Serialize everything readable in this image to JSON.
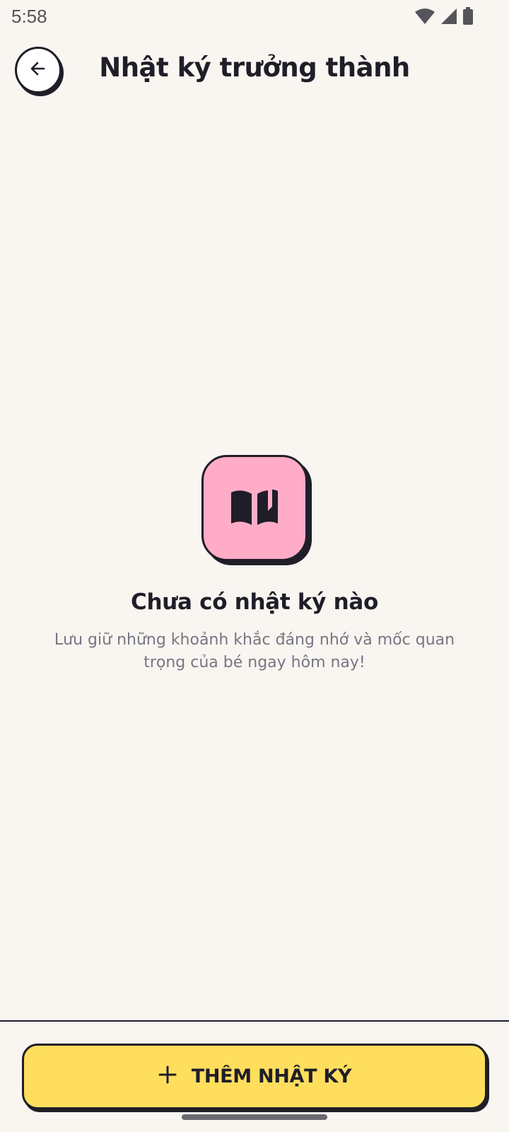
{
  "status_bar": {
    "time": "5:58",
    "icons": [
      "wifi-icon",
      "signal-icon",
      "battery-icon"
    ]
  },
  "header": {
    "title": "Nhật ký trưởng thành",
    "back_icon": "arrow-left-icon"
  },
  "empty_state": {
    "icon": "book-open-icon",
    "title": "Chưa có nhật ký nào",
    "description": "Lưu giữ những khoảnh khắc đáng nhớ và mốc quan trọng của bé ngay hôm nay!"
  },
  "footer": {
    "add_button_icon": "plus-icon",
    "add_button_label": "THÊM NHẬT KÝ"
  },
  "colors": {
    "background": "#F9F5F0",
    "ink": "#1F1E28",
    "icon_tile": "#FFACC8",
    "primary_button": "#FFDE5E",
    "muted_text": "#767684"
  }
}
